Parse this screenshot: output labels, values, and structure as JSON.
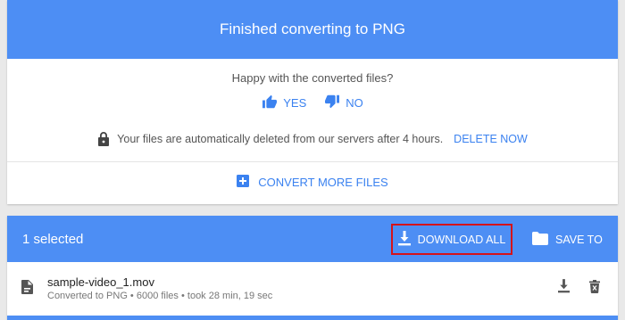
{
  "colors": {
    "accent": "#4d8ef4",
    "link": "#3b82f0",
    "highlight": "#d5131a"
  },
  "header": {
    "title": "Finished converting to PNG"
  },
  "feedback": {
    "question": "Happy with the converted files?",
    "yes_label": "YES",
    "no_label": "NO",
    "yes_icon": "thumb-up-icon",
    "no_icon": "thumb-down-icon"
  },
  "notice": {
    "icon": "lock-icon",
    "text": "Your files are automatically deleted from our servers after 4 hours.",
    "delete_label": "DELETE NOW"
  },
  "convert_more": {
    "icon": "plus-box-icon",
    "label": "CONVERT MORE FILES"
  },
  "toolbar": {
    "selected_text": "1 selected",
    "download_all_label": "DOWNLOAD ALL",
    "save_to_label": "SAVE TO",
    "download_icon": "download-icon",
    "save_icon": "folder-icon"
  },
  "files": [
    {
      "name": "sample-video_1.mov",
      "meta": "Converted to PNG • 6000 files • took 28 min, 19 sec",
      "icon": "file-icon",
      "actions": [
        "download-icon",
        "trash-icon"
      ]
    }
  ]
}
